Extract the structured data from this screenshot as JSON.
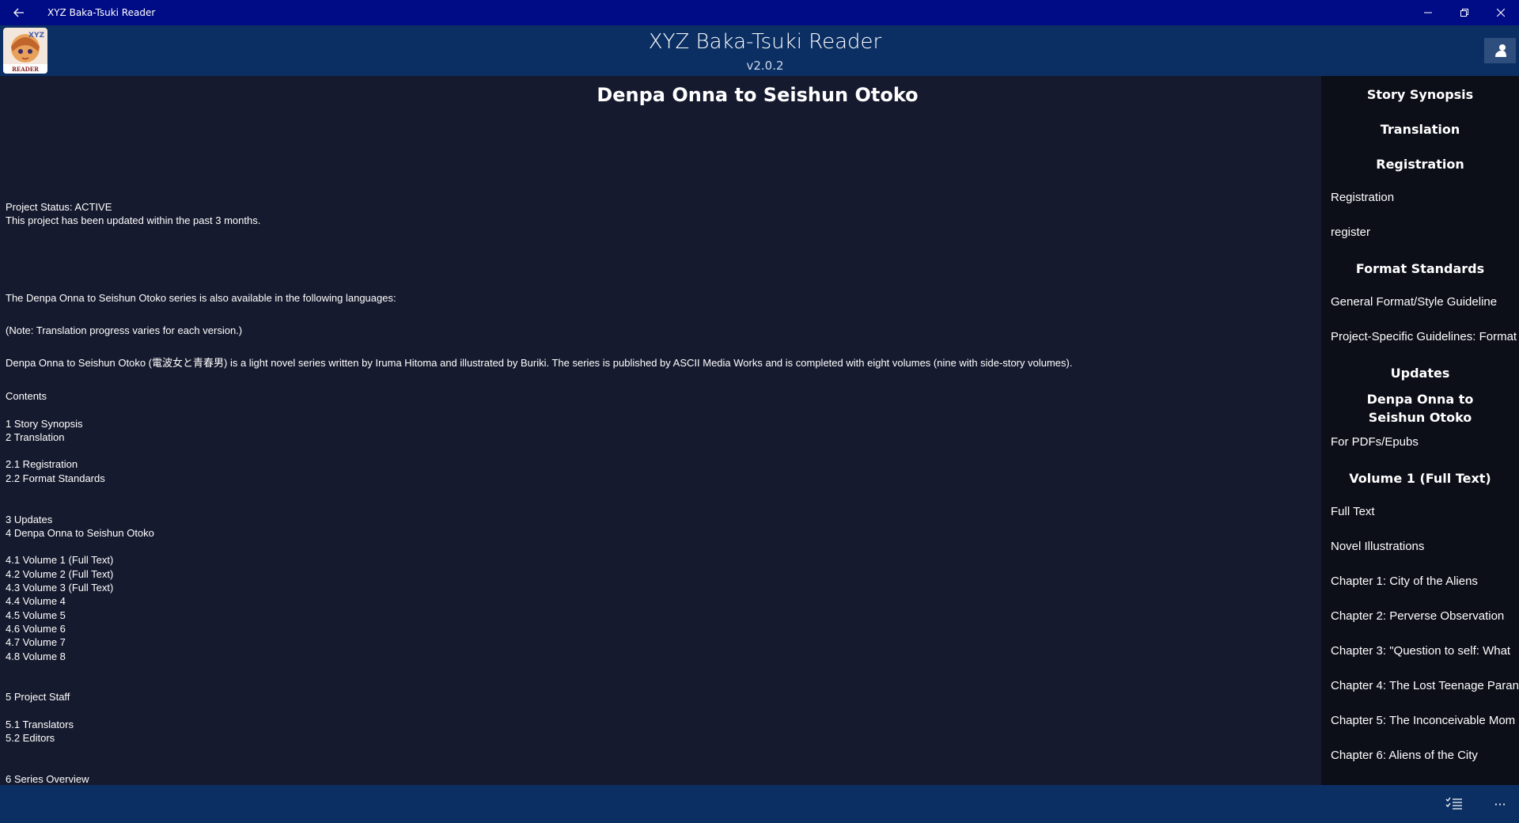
{
  "window": {
    "title": "XYZ Baka-Tsuki Reader"
  },
  "header": {
    "app_title": "XYZ Baka-Tsuki Reader",
    "version": "v2.0.2",
    "logo_text": "XYZ READER"
  },
  "content": {
    "page_title": "Denpa Onna to Seishun Otoko",
    "lines": [
      " Project Status: ACTIVE",
      "This project has been updated within the past 3 months.",
      "The Denpa Onna to Seishun Otoko series is also available in the following languages:",
      "(Note: Translation progress varies for each version.)",
      "Denpa Onna to Seishun Otoko (電波女と青春男) is a light novel series written by Iruma Hitoma and illustrated by Buriki. The series is published by ASCII Media Works and is completed with eight volumes (nine with side-story volumes).",
      "Contents",
      "1 Story Synopsis",
      "2 Translation",
      "2.1 Registration",
      "2.2 Format Standards",
      "3 Updates",
      "4 Denpa Onna to Seishun Otoko",
      "4.1 Volume 1  (Full Text)",
      "4.2 Volume 2  (Full Text)",
      "4.3 Volume 3 (Full Text)",
      "4.4 Volume 4",
      "4.5 Volume 5",
      "4.6 Volume 6",
      "4.7 Volume 7",
      "4.8 Volume 8",
      "5 Project Staff",
      "5.1 Translators",
      "5.2 Editors",
      "6 Series Overview"
    ]
  },
  "sidebar": {
    "items": [
      "Story Synopsis",
      "Translation",
      "Registration",
      "Registration",
      "register",
      "Format Standards",
      "General Format/Style Guideline",
      "Project-Specific Guidelines: Format",
      "Updates",
      "Denpa Onna to Seishun Otoko",
      "For PDFs/Epubs",
      "Volume 1  (Full Text)",
      "Full Text",
      "Novel Illustrations",
      "Chapter 1: City of the Aliens",
      "Chapter 2: Perverse Observation",
      "Chapter 3: \"Question to self: What",
      "Chapter 4: The Lost Teenage Paran",
      "Chapter 5: The Inconceivable Mom",
      "Chapter 6: Aliens of the City"
    ]
  },
  "appbar": {
    "more_label": "···"
  },
  "colors": {
    "titlebar": "#000c85",
    "header": "#0b2f63",
    "content_bg": "#161a2e",
    "sidebar_bg": "#0c0e18"
  }
}
